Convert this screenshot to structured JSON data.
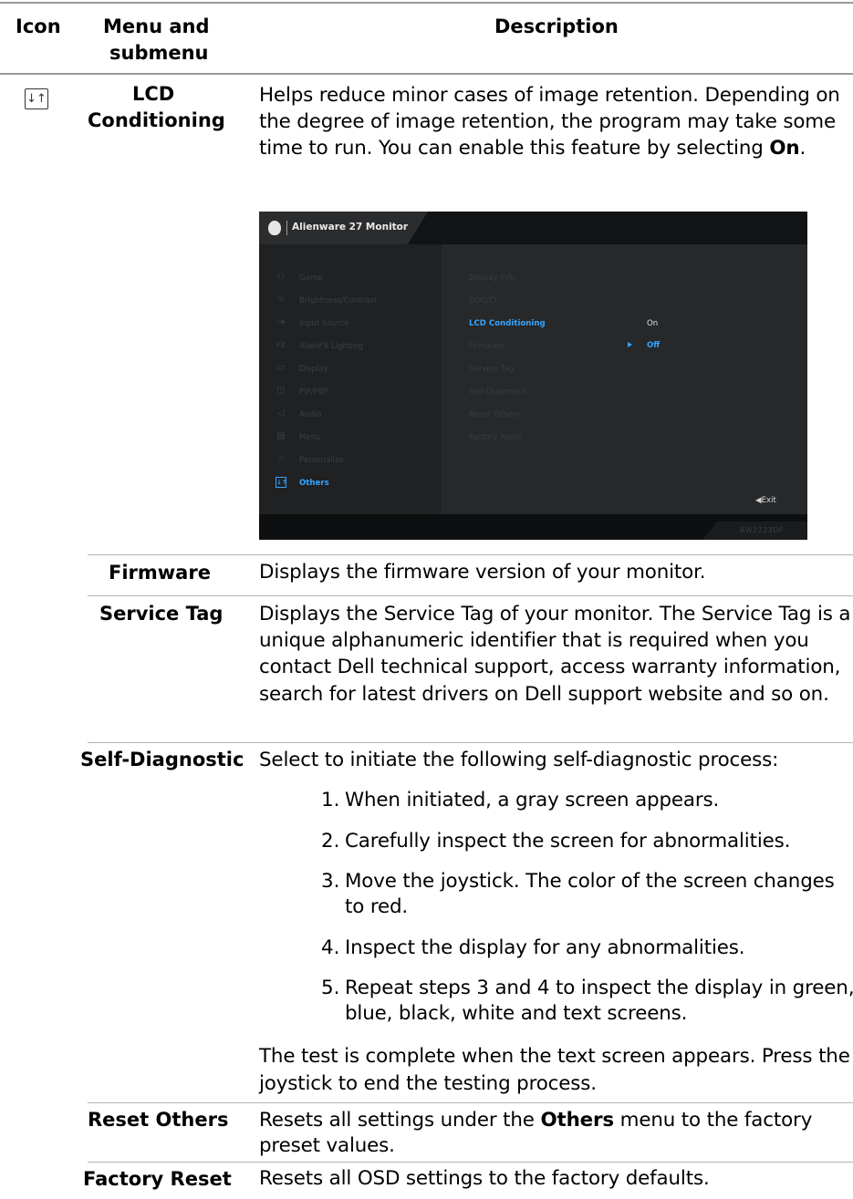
{
  "header": {
    "icon": "Icon",
    "menu_line1": "Menu and",
    "menu_line2": "submenu",
    "description": "Description"
  },
  "lcd": {
    "icon": "others-icon",
    "name_line1": "LCD",
    "name_line2": "Conditioning",
    "desc_before": "Helps reduce minor cases of image retention. Depending on the degree of image retention, the program may take some time to run. You can enable this feature by selecting ",
    "desc_bold": "On",
    "desc_after": "."
  },
  "osd": {
    "title": "Alienware 27 Monitor",
    "menu": [
      {
        "icon": "gamepad-icon",
        "glyph": "⚇",
        "label": "Game"
      },
      {
        "icon": "brightness-icon",
        "glyph": "☼",
        "label": "Brightness/Contrast"
      },
      {
        "icon": "input-source-icon",
        "glyph": "⇥",
        "label": "Input Source"
      },
      {
        "icon": "fx-icon",
        "glyph": "FX",
        "label": "AlienFX Lighting"
      },
      {
        "icon": "display-icon",
        "glyph": "▭",
        "label": "Display"
      },
      {
        "icon": "pip-icon",
        "glyph": "◫",
        "label": "PIP/PBP"
      },
      {
        "icon": "audio-icon",
        "glyph": "◁",
        "label": "Audio"
      },
      {
        "icon": "menu-icon",
        "glyph": "▤",
        "label": "Menu"
      },
      {
        "icon": "star-icon",
        "glyph": "☆",
        "label": "Personalize"
      },
      {
        "icon": "others-icon",
        "glyph": "↓↑",
        "label": "Others"
      }
    ],
    "submenu": [
      "Display Info",
      "DDC/CI",
      "LCD Conditioning",
      "Firmware",
      "Service Tag",
      "Self-Diagnostic",
      "Reset Others",
      "Factory Reset"
    ],
    "options": [
      "On",
      "Off"
    ],
    "exit": "◀Exit",
    "model": "AW2723DF"
  },
  "firmware": {
    "name": "Firmware",
    "desc": "Displays the firmware version of your monitor."
  },
  "service_tag": {
    "name": "Service Tag",
    "desc": "Displays the Service Tag of your monitor. The Service Tag is a unique alphanumeric identifier that is required when you contact Dell technical support, access warranty information, search for latest drivers on Dell support website and so on."
  },
  "self_diagnostic": {
    "name": "Self-Diagnostic",
    "intro": "Select to initiate the following self-diagnostic process:",
    "steps": [
      {
        "num": "1.",
        "text": "When initiated, a gray screen appears."
      },
      {
        "num": "2.",
        "text": "Carefully inspect the screen for abnormalities."
      },
      {
        "num": "3.",
        "text": "Move the joystick. The color of the screen changes to red."
      },
      {
        "num": "4.",
        "text": "Inspect the display for any abnormalities."
      },
      {
        "num": "5.",
        "text": "Repeat steps 3 and 4 to inspect the display in green, blue, black, white and text screens."
      }
    ],
    "outro": "The test is complete when the text screen appears. Press the joystick to end the testing process."
  },
  "reset_others": {
    "name": "Reset Others",
    "desc_before": "Resets all settings under the ",
    "desc_bold": "Others",
    "desc_after": " menu to the factory preset values."
  },
  "factory_reset": {
    "name": "Factory Reset",
    "desc": "Resets all OSD settings to the factory defaults."
  }
}
